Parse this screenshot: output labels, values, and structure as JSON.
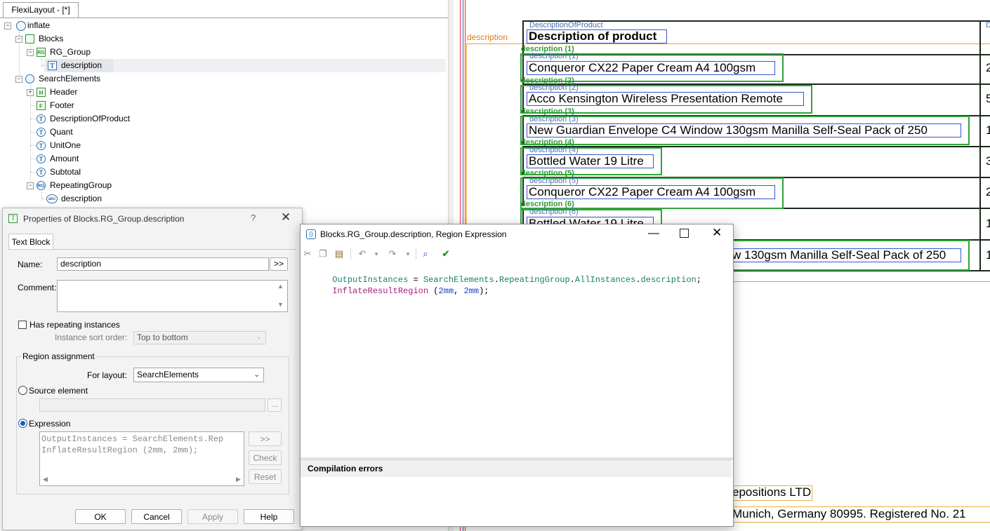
{
  "tree_panel": {
    "tab_label": "FlexiLayout - [*]",
    "nodes": [
      {
        "label": "inflate",
        "icon": "globe-icon"
      },
      {
        "label": "Blocks",
        "icon": "blocks-icon"
      },
      {
        "label": "RG_Group",
        "icon": "repeating-group-icon"
      },
      {
        "label": "description",
        "icon": "text-block-icon"
      },
      {
        "label": "SearchElements",
        "icon": "search-elements-icon"
      },
      {
        "label": "Header",
        "icon": "header-icon"
      },
      {
        "label": "Footer",
        "icon": "footer-icon"
      },
      {
        "label": "DescriptionOfProduct",
        "icon": "text-element-icon"
      },
      {
        "label": "Quant",
        "icon": "text-element-icon"
      },
      {
        "label": "UnitOne",
        "icon": "text-element-icon"
      },
      {
        "label": "Amount",
        "icon": "text-element-icon"
      },
      {
        "label": "Subtotal",
        "icon": "text-element-icon"
      },
      {
        "label": "RepeatingGroup",
        "icon": "repeating-group-icon"
      },
      {
        "label": "description",
        "icon": "character-string-icon"
      }
    ],
    "icon_glyphs": {
      "T": "T",
      "RG": "RG",
      "H": "H",
      "F": "F",
      "abc": "abc"
    }
  },
  "canvas": {
    "region_label": "description",
    "header_small_label": "DescriptionOfProduct",
    "header_text": "Description of product",
    "right_edge_small": "D",
    "rows": [
      {
        "green_label": "description (1)",
        "small_label": "description (1)",
        "text": "Conqueror CX22 Paper Cream A4 100gsm",
        "right_digit": "2"
      },
      {
        "green_label": "description (2)",
        "small_label": "description (2)",
        "text": "Acco Kensington Wireless Presentation Remote",
        "right_digit": "5"
      },
      {
        "green_label": "description (3)",
        "small_label": "description (3)",
        "text": "New Guardian Envelope C4 Window 130gsm Manilla Self-Seal Pack of 250",
        "right_digit": "1"
      },
      {
        "green_label": "description (4)",
        "small_label": "description (4)",
        "text": "Bottled Water 19 Litre",
        "right_digit": "3"
      },
      {
        "green_label": "description (5)",
        "small_label": "description (5)",
        "text": "Conqueror CX22 Paper Cream A4 100gsm",
        "right_digit": "2"
      },
      {
        "green_label": "description (6)",
        "small_label": "description (6)",
        "text": "Bottled Water 19 Litre",
        "right_digit": "1"
      },
      {
        "text": "w 130gsm Manilla Self-Seal Pack of 250",
        "right_digit": "1"
      }
    ],
    "footer_line1": "epositions LTD",
    "footer_line2": "Munich, Germany 80995. Registered No. 21"
  },
  "properties_dialog": {
    "title": "Properties of Blocks.RG_Group.description",
    "help_glyph": "?",
    "tab": "Text Block",
    "name_label": "Name:",
    "name_value": "description",
    "name_btn": ">>",
    "comment_label": "Comment:",
    "has_repeating_label": "Has repeating instances",
    "sort_order_label": "Instance sort order:",
    "sort_order_value": "Top to bottom",
    "region_assignment_label": "Region assignment",
    "for_layout_label": "For layout:",
    "for_layout_value": "SearchElements",
    "source_element_label": "Source element",
    "source_browse": "...",
    "expression_label": "Expression",
    "expr_line1": "OutputInstances = SearchElements.Rep",
    "expr_line2": "InflateResultRegion (2mm, 2mm);",
    "expr_btn": ">>",
    "check_btn": "Check",
    "reset_btn": "Reset",
    "ok_btn": "OK",
    "cancel_btn": "Cancel",
    "apply_btn": "Apply",
    "help_btn": "Help"
  },
  "region_window": {
    "title": "Blocks.RG_Group.description, Region Expression",
    "code_line1": {
      "a": "OutputInstances",
      "b": " = ",
      "c": "SearchElements",
      "d": ".",
      "e": "RepeatingGroup",
      "f": ".",
      "g": "AllInstances",
      "h": ".",
      "i": "description",
      "j": ";"
    },
    "code_line2": {
      "a": "InflateResultRegion",
      "b": " (",
      "c": "2mm",
      "d": ", ",
      "e": "2mm",
      "f": ");"
    },
    "errors_label": "Compilation errors"
  },
  "colors": {
    "accent": "#1a5fb4",
    "green_frame": "#2fa53a",
    "blue_frame": "#3a55c8",
    "orange_region": "#e8a030"
  }
}
